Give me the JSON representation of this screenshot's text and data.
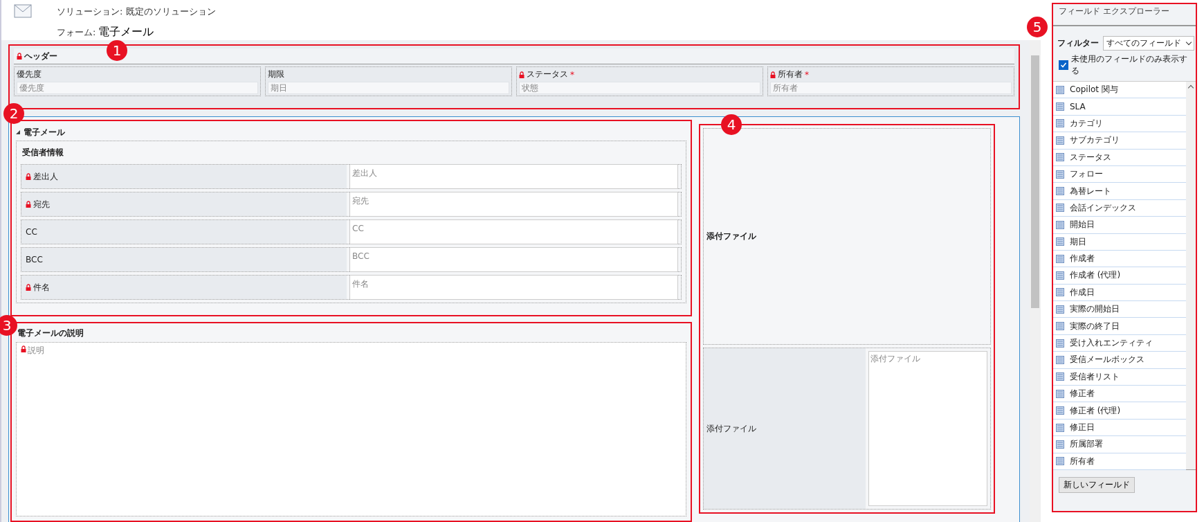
{
  "page_header": {
    "solution_label": "ソリューション: 既定のソリューション",
    "form_label": "フォーム:",
    "form_name": "電子メール"
  },
  "header_section": {
    "badge": "1",
    "title": "ヘッダー",
    "locked": true,
    "fields": [
      {
        "label": "優先度",
        "placeholder": "優先度",
        "locked": false
      },
      {
        "label": "期限",
        "placeholder": "期日",
        "locked": false
      },
      {
        "label": "ステータス",
        "placeholder": "状態",
        "locked": true,
        "required_mark": "*"
      },
      {
        "label": "所有者",
        "placeholder": "所有者",
        "locked": true,
        "required_mark": "*"
      }
    ]
  },
  "email_section": {
    "badge": "2",
    "tab_title": "電子メール",
    "title": "受信者情報",
    "fields": [
      {
        "label": "差出人",
        "placeholder": "差出人",
        "locked": true
      },
      {
        "label": "宛先",
        "placeholder": "宛先",
        "locked": true
      },
      {
        "label": "CC",
        "placeholder": "CC",
        "locked": false
      },
      {
        "label": "BCC",
        "placeholder": "BCC",
        "locked": false
      },
      {
        "label": "件名",
        "placeholder": "件名",
        "locked": true
      }
    ]
  },
  "description_section": {
    "badge": "3",
    "title": "電子メールの説明",
    "field": {
      "placeholder": "説明",
      "locked": true
    }
  },
  "attachment_section": {
    "badge": "4",
    "title": "添付ファイル",
    "field": {
      "label": "添付ファイル",
      "placeholder": "添付ファイル"
    }
  },
  "field_explorer": {
    "badge": "5",
    "title": "フィールド エクスプローラー",
    "filter_label": "フィルター",
    "filter_value": "すべてのフィールド",
    "unused_only": {
      "label": "未使用のフィールドのみ表示する",
      "checked": true
    },
    "items": [
      "Copilot 関与",
      "SLA",
      "カテゴリ",
      "サブカテゴリ",
      "ステータス",
      "フォロー",
      "為替レート",
      "会話インデックス",
      "開始日",
      "期日",
      "作成者",
      "作成者 (代理)",
      "作成日",
      "実際の開始日",
      "実際の終了日",
      "受け入れエンティティ",
      "受信メールボックス",
      "受信者リスト",
      "修正者",
      "修正者 (代理)",
      "修正日",
      "所属部署",
      "所有者"
    ],
    "new_field_button": "新しいフィールド"
  }
}
